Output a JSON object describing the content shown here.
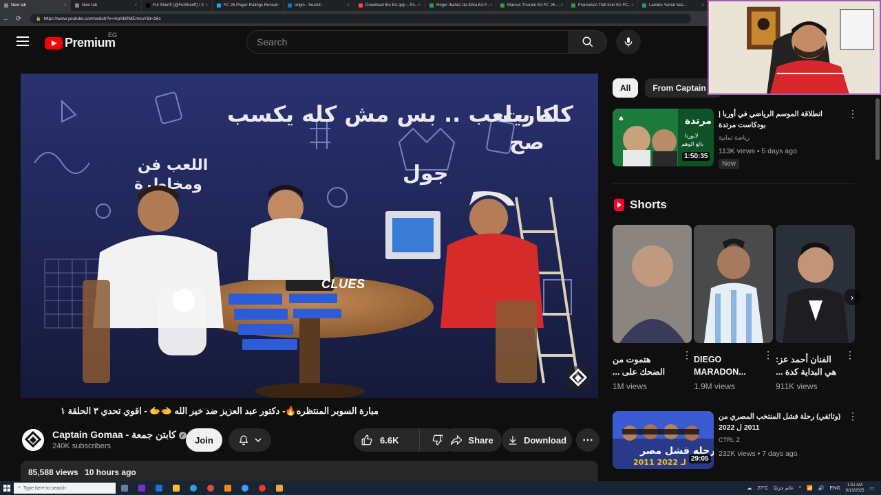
{
  "browser": {
    "tabs": [
      {
        "label": "New tab",
        "color": "#888"
      },
      {
        "label": "New tab",
        "color": "#888"
      },
      {
        "label": "Fut Sheriff (@FutSheriff) / X",
        "color": "#000"
      },
      {
        "label": "FC 26 Player Ratings Reveal",
        "color": "#1da1f2"
      },
      {
        "label": "origin - Search",
        "color": "#0078d4"
      },
      {
        "label": "Download the EA app – Po...",
        "color": "#ff4747"
      },
      {
        "label": "Roger Ibañez da Silva EA F...",
        "color": "#2e9a4e"
      },
      {
        "label": "Marcus Thuram EA FC 26 -...",
        "color": "#2e9a4e"
      },
      {
        "label": "Francesco Totti Icon EA FC...",
        "color": "#2e9a4e"
      },
      {
        "label": "Lamine Yamal Nas...",
        "color": "#2e9a4e"
      }
    ],
    "url": "https://www.youtube.com/watch?v=mpXbRMEmvuY&t=16s"
  },
  "header": {
    "logo_text": "Premium",
    "country_code": "EG",
    "search_placeholder": "Search"
  },
  "video": {
    "title": "مبارة السوبر المنتظره🔥- دكتور عبد العزيز ضد خير الله 🫲🫱 - اقوي تحدي ٣ الحلقة ١",
    "overlay_text": "CLUES",
    "channel_name": "Captain Gomaa - كابتن جمعة",
    "verified": "✓",
    "subscribers": "240K subscribers",
    "join_label": "Join",
    "likes": "6.6K",
    "share_label": "Share",
    "download_label": "Download",
    "views": "85,588 views",
    "time_ago": "10 hours ago"
  },
  "sidebar": {
    "chips": [
      "All",
      "From Captain G"
    ],
    "recs": [
      {
        "title": "انطلاقة الموسم الرياضي في أوربا | بودكاست مرتدة",
        "channel": "رياضة ثمانية",
        "meta": "113K views • 5 days ago",
        "badge": "New",
        "duration": "1:50:35"
      },
      {
        "title": "(وثائقي) رحلة فشل المنتخب المصري من 2011 ل 2022",
        "channel": "CTRL Z",
        "meta": "232K views • 7 days ago",
        "badge": "",
        "duration": "29:05"
      }
    ],
    "shorts_heading": "Shorts",
    "shorts": [
      {
        "title": "هتموت من الضحك على ...",
        "views": "1M views"
      },
      {
        "title": "DIEGO MARADON...",
        "views": "1.9M views"
      },
      {
        "title": "الفنان أحمد عز: هي البداية كدة ...",
        "views": "911K views"
      }
    ]
  },
  "taskbar": {
    "search_placeholder": "Type here to search",
    "weather": "27°C",
    "weather_text": "غائم جزئيًا",
    "lang": "ENG",
    "time": "1:51 AM",
    "date": "9/13/2025"
  },
  "colors": {
    "background": "#0f0f0f",
    "brand_red": "#ff0000",
    "surface": "#272727"
  }
}
